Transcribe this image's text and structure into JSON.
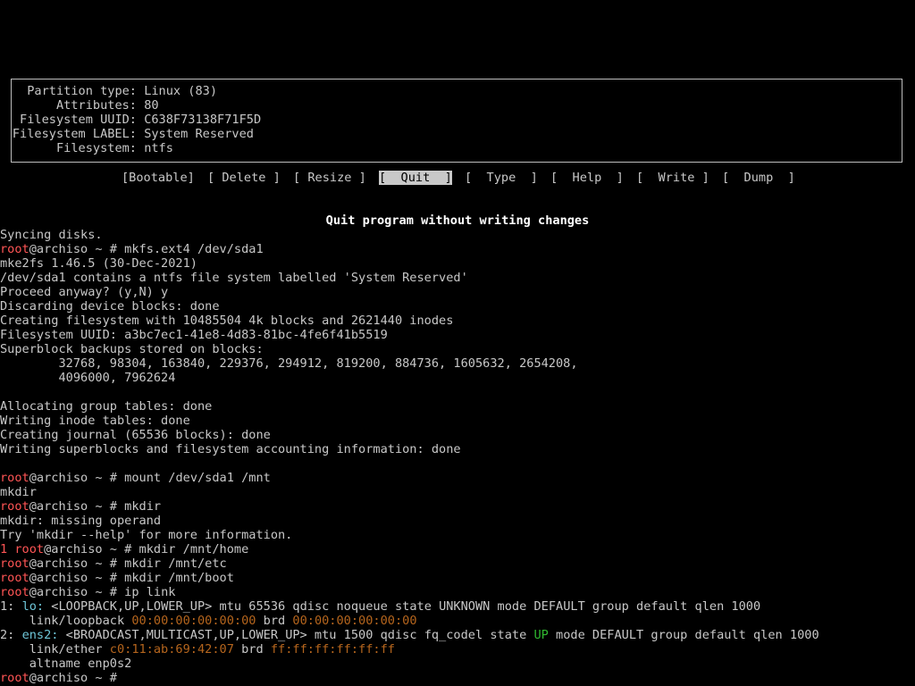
{
  "colors": {
    "background": "#000000",
    "text": "#c8c8c8",
    "prompt_user": "#ff5555",
    "link_state_up": "#2fb82f",
    "mac_address": "#b5651d",
    "iface_name": "#6ec6d8"
  },
  "partition_info": {
    "rows": [
      {
        "label": "Partition type:",
        "value": "Linux (83)"
      },
      {
        "label": "Attributes:",
        "value": "80"
      },
      {
        "label": "Filesystem UUID:",
        "value": "C638F73138F71F5D"
      },
      {
        "label": "Filesystem LABEL:",
        "value": "System Reserved"
      },
      {
        "label": "Filesystem:",
        "value": "ntfs"
      }
    ]
  },
  "menu": {
    "items": [
      "[Bootable]",
      "[ Delete ]",
      "[ Resize ]",
      "[  Quit  ]",
      "[  Type  ]",
      "[  Help  ]",
      "[  Write ]",
      "[  Dump  ]"
    ],
    "selected": "[  Quit  ]"
  },
  "hint": "Quit program without writing changes",
  "prompt": {
    "user": "root",
    "host_path": "@archiso ~ # "
  },
  "terminal": {
    "l01": "Syncing disks.",
    "l02_cmd": "mkfs.ext4 /dev/sda1",
    "l03": "mke2fs 1.46.5 (30-Dec-2021)",
    "l04": "/dev/sda1 contains a ntfs file system labelled 'System Reserved'",
    "l05": "Proceed anyway? (y,N) y",
    "l06": "Discarding device blocks: done",
    "l07": "Creating filesystem with 10485504 4k blocks and 2621440 inodes",
    "l08": "Filesystem UUID: a3bc7ec1-41e8-4d83-81bc-4fe6f41b5519",
    "l09": "Superblock backups stored on blocks:",
    "l10": "        32768, 98304, 163840, 229376, 294912, 819200, 884736, 1605632, 2654208,",
    "l11": "        4096000, 7962624",
    "l13": "Allocating group tables: done",
    "l14": "Writing inode tables: done",
    "l15": "Creating journal (65536 blocks): done",
    "l16": "Writing superblocks and filesystem accounting information: done",
    "l18_cmd": "mount /dev/sda1 /mnt",
    "l19": "mkdir",
    "l20_cmd": "mkdir",
    "l21": "mkdir: missing operand",
    "l22": "Try 'mkdir --help' for more information.",
    "l23_status": "1 ",
    "l23_cmd": "mkdir /mnt/home",
    "l24_cmd": "mkdir /mnt/etc",
    "l25_cmd": "mkdir /mnt/boot",
    "l26_cmd": "ip link",
    "l27_pre": "1: ",
    "l27_iface": "lo:",
    "l27_rest": " <LOOPBACK,UP,LOWER_UP> mtu 65536 qdisc noqueue state UNKNOWN mode DEFAULT group default qlen 1000",
    "l28_pre": "    link/loopback ",
    "l28_mac": "00:00:00:00:00:00",
    "l28_mid": " brd ",
    "l28_brd": "00:00:00:00:00:00",
    "l29_pre": "2: ",
    "l29_iface": "ens2:",
    "l29_mid": " <BROADCAST,MULTICAST,UP,LOWER_UP> mtu 1500 qdisc fq_codel state ",
    "l29_state": "UP",
    "l29_rest": " mode DEFAULT group default qlen 1000",
    "l30_pre": "    link/ether ",
    "l30_mac": "c0:11:ab:69:42:07",
    "l30_mid": " brd ",
    "l30_brd": "ff:ff:ff:ff:ff:ff",
    "l31": "    altname enp0s2"
  }
}
